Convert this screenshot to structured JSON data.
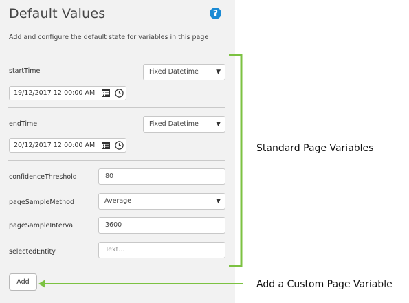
{
  "panel": {
    "title": "Default Values",
    "help_icon": "?",
    "description": "Add and configure the default state for variables in this page",
    "variables": [
      {
        "name": "startTime",
        "mode": "Fixed Datetime",
        "value": "19/12/2017 12:00:00 AM"
      },
      {
        "name": "endTime",
        "mode": "Fixed Datetime",
        "value": "20/12/2017 12:00:00 AM"
      },
      {
        "name": "confidenceThreshold",
        "value": "80"
      },
      {
        "name": "pageSampleMethod",
        "value": "Average"
      },
      {
        "name": "pageSampleInterval",
        "value": "3600"
      },
      {
        "name": "selectedEntity",
        "placeholder": "Text..."
      }
    ],
    "add_button": "Add"
  },
  "callouts": {
    "standard": "Standard Page Variables",
    "custom": "Add a Custom Page Variable"
  },
  "colors": {
    "panel_bg": "#f2f2f2",
    "accent_green": "#7cc242",
    "help_blue": "#1a8ad4"
  }
}
